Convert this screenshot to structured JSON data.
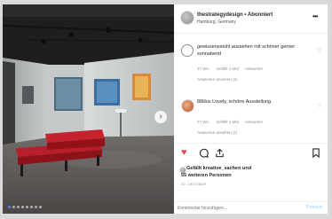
{
  "header": {
    "username": "thestrategydesign • Abonniert",
    "location": "Hamburg, Germany",
    "more_icon": "more-horizontal-icon"
  },
  "comments": [
    {
      "username": "gewissensstuhl",
      "text": "gewissensstuhl aussehen mit schöner gerner sonnabend",
      "time": "27 Wo.",
      "likes": "Gefällt 1 Mal",
      "reply": "Antworten",
      "replies": "Antworten ansehen (1)"
    },
    {
      "username": "88illus",
      "text": "88illus Lovely, schöne Ausstellung",
      "time": "27 Wo.",
      "likes": "Gefällt 1 Mal",
      "reply": "Antworten",
      "replies": "Antworten ansehen (1)"
    }
  ],
  "likes_line_1": "Gefällt kreative_sachen und",
  "likes_line_2": "55 weiteren Personen",
  "timestamp": "20. OKTOBER",
  "comment_placeholder": "Kommentar hinzufügen...",
  "post_label": "Posten",
  "colors": {
    "like": "#ed4956",
    "post": "#b3dbff"
  }
}
